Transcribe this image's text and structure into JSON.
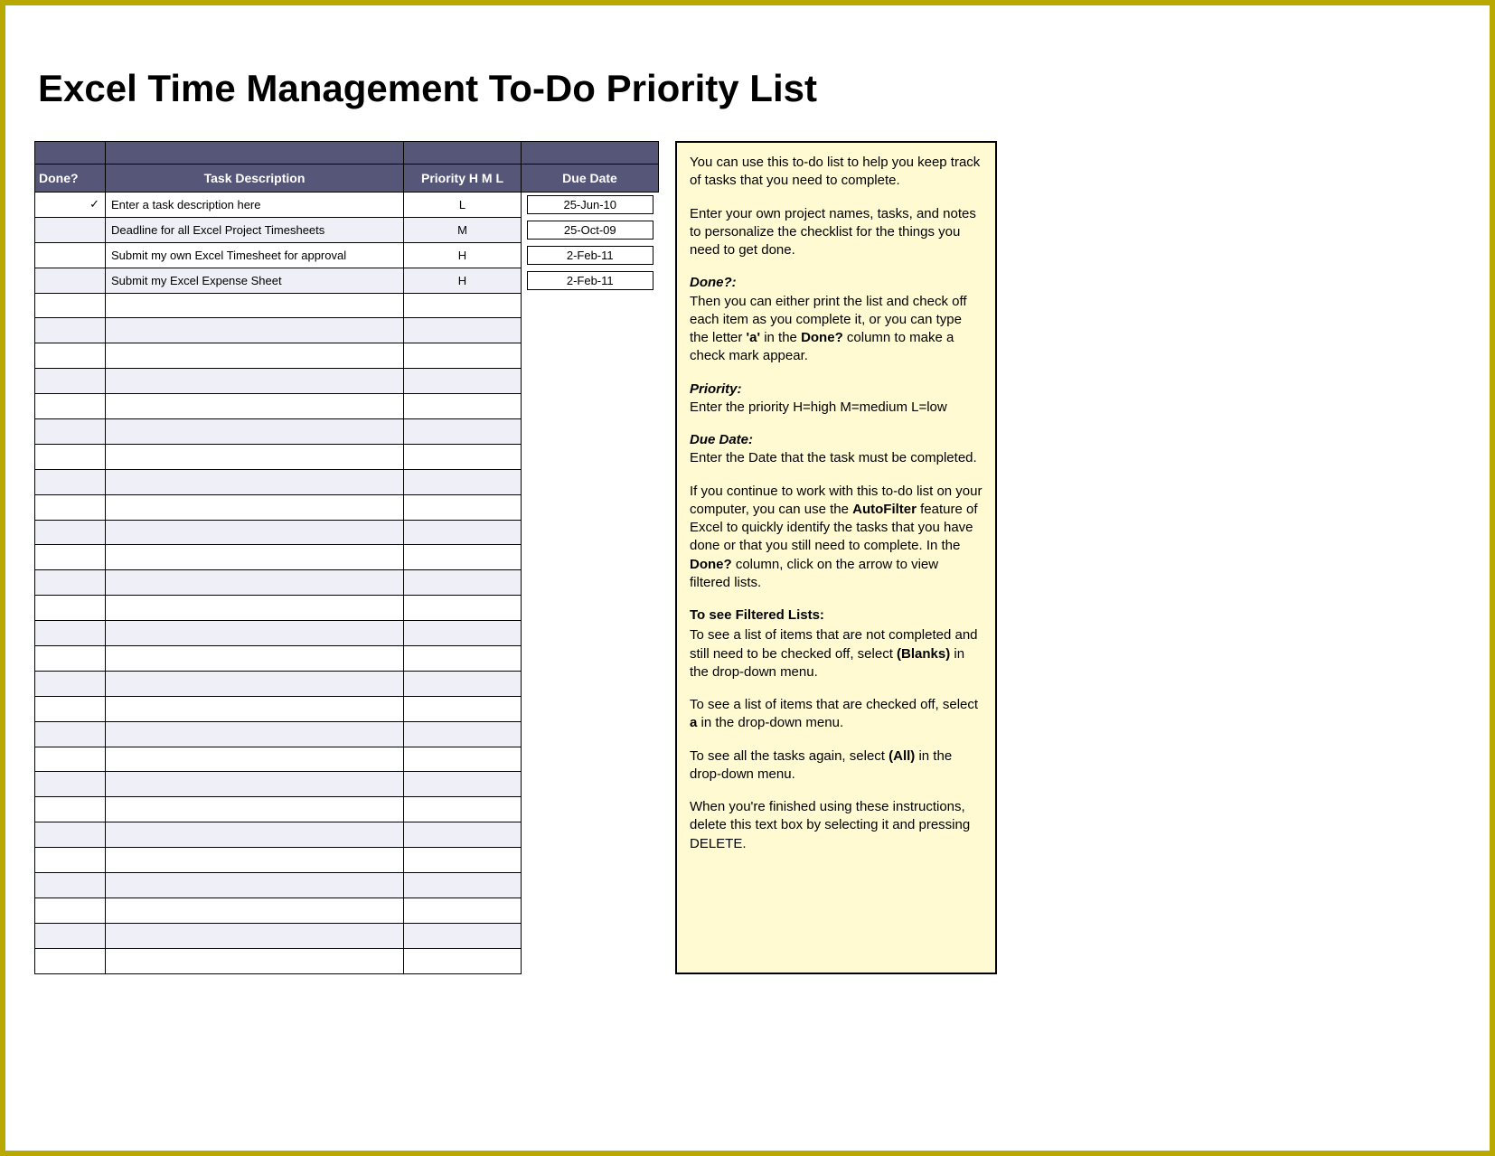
{
  "title": "Excel Time Management To-Do Priority List",
  "columns": {
    "done": "Done?",
    "task": "Task Description",
    "priority": "Priority H M L",
    "due": "Due Date"
  },
  "rows": [
    {
      "done": "a",
      "task": "Enter a task description here",
      "priority": "L",
      "due": "25-Jun-10"
    },
    {
      "done": "",
      "task": "Deadline for all Excel Project Timesheets",
      "priority": "M",
      "due": "25-Oct-09"
    },
    {
      "done": "",
      "task": "Submit my own Excel Timesheet for approval",
      "priority": "H",
      "due": "2-Feb-11"
    },
    {
      "done": "",
      "task": "Submit my Excel Expense Sheet",
      "priority": "H",
      "due": "2-Feb-11"
    },
    {
      "done": "",
      "task": "",
      "priority": "",
      "due": ""
    },
    {
      "done": "",
      "task": "",
      "priority": "",
      "due": ""
    },
    {
      "done": "",
      "task": "",
      "priority": "",
      "due": ""
    },
    {
      "done": "",
      "task": "",
      "priority": "",
      "due": ""
    },
    {
      "done": "",
      "task": "",
      "priority": "",
      "due": ""
    },
    {
      "done": "",
      "task": "",
      "priority": "",
      "due": ""
    },
    {
      "done": "",
      "task": "",
      "priority": "",
      "due": ""
    },
    {
      "done": "",
      "task": "",
      "priority": "",
      "due": ""
    },
    {
      "done": "",
      "task": "",
      "priority": "",
      "due": ""
    },
    {
      "done": "",
      "task": "",
      "priority": "",
      "due": ""
    },
    {
      "done": "",
      "task": "",
      "priority": "",
      "due": ""
    },
    {
      "done": "",
      "task": "",
      "priority": "",
      "due": ""
    },
    {
      "done": "",
      "task": "",
      "priority": "",
      "due": ""
    },
    {
      "done": "",
      "task": "",
      "priority": "",
      "due": ""
    },
    {
      "done": "",
      "task": "",
      "priority": "",
      "due": ""
    },
    {
      "done": "",
      "task": "",
      "priority": "",
      "due": ""
    },
    {
      "done": "",
      "task": "",
      "priority": "",
      "due": ""
    },
    {
      "done": "",
      "task": "",
      "priority": "",
      "due": ""
    },
    {
      "done": "",
      "task": "",
      "priority": "",
      "due": ""
    },
    {
      "done": "",
      "task": "",
      "priority": "",
      "due": ""
    },
    {
      "done": "",
      "task": "",
      "priority": "",
      "due": ""
    },
    {
      "done": "",
      "task": "",
      "priority": "",
      "due": ""
    },
    {
      "done": "",
      "task": "",
      "priority": "",
      "due": ""
    },
    {
      "done": "",
      "task": "",
      "priority": "",
      "due": ""
    },
    {
      "done": "",
      "task": "",
      "priority": "",
      "due": ""
    },
    {
      "done": "",
      "task": "",
      "priority": "",
      "due": ""
    },
    {
      "done": "",
      "task": "",
      "priority": "",
      "due": ""
    }
  ],
  "instructions": {
    "p1": "You can use this to-do list to help you keep track of tasks that you need to complete.",
    "p2": "Enter your own project names, tasks, and notes to personalize the checklist for the things you need to get done.",
    "h_done": "Done?:",
    "p_done_a": "Then you can either print the list and check off each item as you complete it, or you can type the letter ",
    "p_done_b": "'a'",
    "p_done_c": " in the ",
    "p_done_d": "Done?",
    "p_done_e": " column to make a check mark appear.",
    "h_priority": "Priority:",
    "p_priority": "Enter the priority  H=high M=medium L=low",
    "h_due": "Due Date:",
    "p_due": "Enter the Date that the task must be completed.",
    "p_autofilter_a": "If you continue to work with this to-do list on your computer, you can use the ",
    "p_autofilter_b": "AutoFilter",
    "p_autofilter_c": " feature of Excel to quickly identify the tasks that you have done or that you still need to complete. In the ",
    "p_autofilter_d": "Done?",
    "p_autofilter_e": " column, click on the arrow to view filtered lists.",
    "h_filtered": "To see Filtered Lists:",
    "p_blanks_a": "To see a list of items that are not completed and still need to be checked off, select ",
    "p_blanks_b": "(Blanks)",
    "p_blanks_c": " in the drop-down menu.",
    "p_checked_a": "To see a list of items that are checked off, select ",
    "p_checked_b": "a",
    "p_checked_c": " in the drop-down menu.",
    "p_all_a": "To see all the tasks again, select ",
    "p_all_b": "(All)",
    "p_all_c": " in the drop-down menu.",
    "p_delete": "When you're finished using these instructions, delete this text box by selecting it and pressing DELETE."
  }
}
